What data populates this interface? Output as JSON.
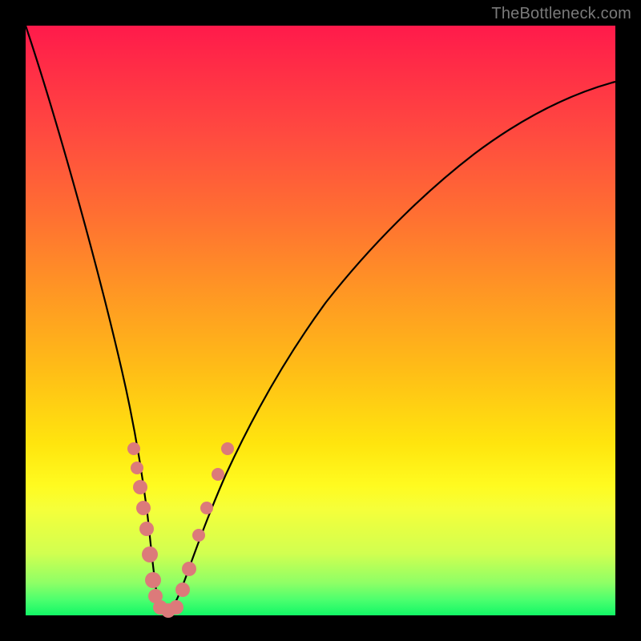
{
  "watermark": "TheBottleneck.com",
  "chart_data": {
    "type": "line",
    "title": "",
    "xlabel": "",
    "ylabel": "",
    "xlim": [
      0,
      100
    ],
    "ylim": [
      0,
      100
    ],
    "grid": false,
    "series": [
      {
        "name": "curve",
        "x": [
          0,
          2,
          4,
          6,
          8,
          10,
          12,
          14,
          16,
          17,
          18,
          19,
          20,
          21,
          22,
          23,
          24,
          25,
          27,
          29,
          32,
          36,
          41,
          47,
          54,
          62,
          71,
          80,
          90,
          100
        ],
        "y": [
          100,
          89,
          79,
          69,
          59,
          49,
          40,
          31,
          22,
          18,
          14,
          10,
          6,
          3,
          1.5,
          1,
          1.5,
          2.5,
          5,
          9,
          15,
          23,
          33,
          44,
          55,
          65,
          74,
          81,
          86,
          90
        ]
      }
    ],
    "markers": {
      "name": "highlight-points",
      "color": "#dc7a7a",
      "left_branch_y": [
        28,
        24,
        21,
        18,
        15,
        12,
        6,
        4
      ],
      "right_branch_y": [
        4,
        6,
        12,
        16,
        22,
        26
      ],
      "bottom_trough_y": [
        1,
        1,
        1,
        1
      ]
    },
    "colors": {
      "curve": "#000000",
      "marker": "#dc7a7a",
      "gradient_top": "#ff1a4b",
      "gradient_mid": "#ffd414",
      "gradient_bottom": "#12f766",
      "frame": "#000000"
    }
  }
}
